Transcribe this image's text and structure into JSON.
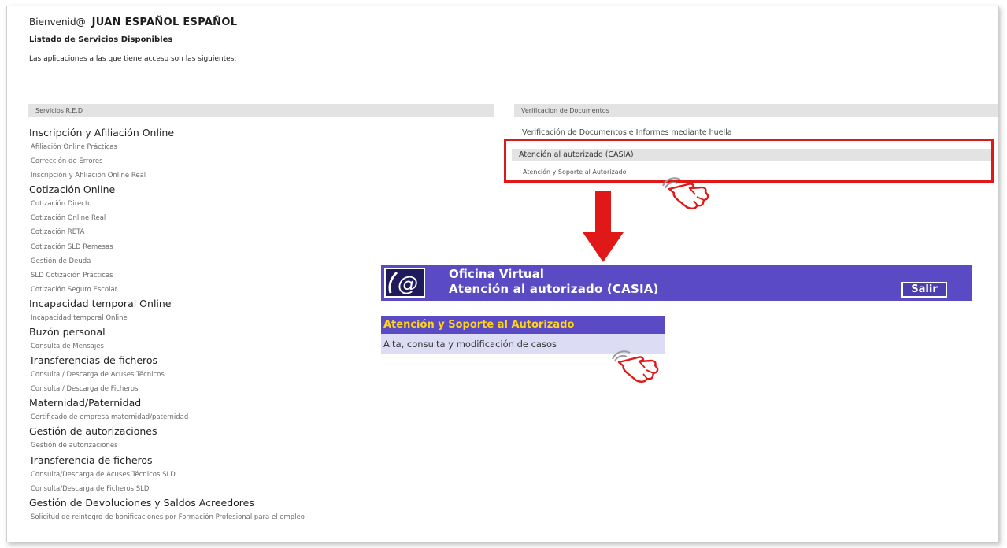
{
  "header": {
    "welcome_prefix": "Bienvenid@",
    "user_name": "JUAN ESPAÑOL ESPAÑOL",
    "listado_title": "Listado de Servicios Disponibles",
    "apps_intro": "Las aplicaciones a las que tiene acceso son las siguientes:"
  },
  "left_column": {
    "header": "Servicios R.E.D",
    "sections": [
      {
        "title": "Inscripción y Afiliación Online",
        "links": [
          "Afiliación Online Prácticas",
          "Corrección de Errores",
          "Inscripción y Afiliación Online Real"
        ]
      },
      {
        "title": "Cotización Online",
        "links": [
          "Cotización Directo",
          "Cotización Online Real",
          "Cotización RETA",
          "Cotización SLD Remesas",
          "Gestión de Deuda",
          "SLD Cotización Prácticas",
          "Cotización Seguro Escolar"
        ]
      },
      {
        "title": "Incapacidad temporal Online",
        "links": [
          "Incapacidad temporal Online"
        ]
      },
      {
        "title": "Buzón personal",
        "links": [
          "Consulta de Mensajes"
        ]
      },
      {
        "title": "Transferencias de ficheros",
        "links": [
          "Consulta / Descarga de Acuses Técnicos",
          "Consulta / Descarga de Ficheros"
        ]
      },
      {
        "title": "Maternidad/Paternidad",
        "links": [
          "Certificado de empresa maternidad/paternidad"
        ]
      },
      {
        "title": "Gestión de autorizaciones",
        "links": [
          "Gestión de autorizaciones"
        ]
      },
      {
        "title": "Transferencia de ficheros",
        "links": [
          "Consulta/Descarga de Acuses Técnicos SLD",
          "Consulta/Descarga de Ficheros SLD"
        ]
      },
      {
        "title": "Gestión de Devoluciones y Saldos Acreedores",
        "links": [
          "Solicitud de reintegro de bonificaciones por Formación Profesional para el empleo"
        ]
      }
    ]
  },
  "right_column": {
    "header": "Verificacion de Documentos",
    "verif_link": "Verificación de Documentos e Informes mediante huella",
    "casia_header": "Atención al autorizado (CASIA)",
    "casia_link": "Atención y Soporte al Autorizado"
  },
  "oficina_virtual": {
    "title_line1": "Oficina Virtual",
    "title_line2": "Atención al autorizado (CASIA)",
    "salir_label": "Salir",
    "section_title": "Atención y Soporte al Autorizado",
    "row_link": "Alta, consulta y modificación de casos"
  },
  "colors": {
    "highlight_red": "#e01818",
    "banner_purple": "#5a4bc4",
    "section_yellow": "#ffd319"
  },
  "icons": [
    "email-at-logo-icon",
    "pointing-hand-click-icon",
    "down-arrow-icon"
  ]
}
